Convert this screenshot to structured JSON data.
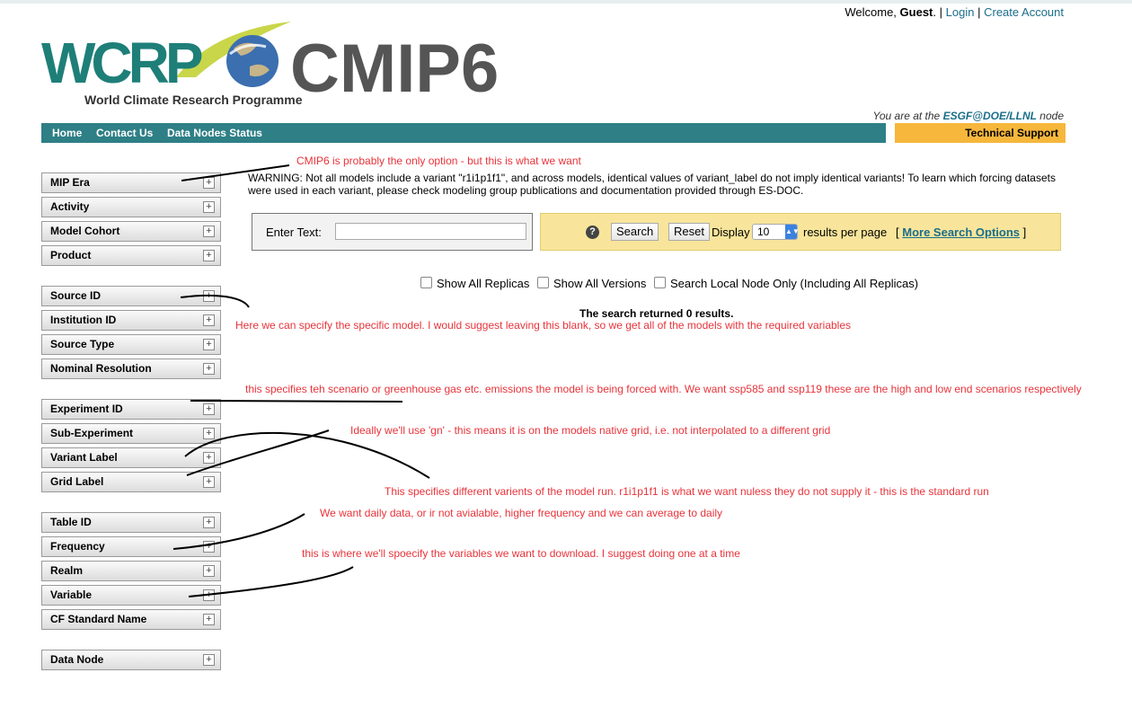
{
  "header": {
    "welcome_prefix": "Welcome,",
    "user": "Guest",
    "welcome_suffix": ".",
    "sep1": "|",
    "login": "Login",
    "sep2": "|",
    "create_account": "Create Account",
    "node_prefix": "You are at the",
    "node_name": "ESGF@DOE/LLNL",
    "node_suffix": "node"
  },
  "logo": {
    "wcrp": "WCRP",
    "tagline": "World Climate Research Programme",
    "cmip": "CMIP6"
  },
  "nav": {
    "items": [
      "Home",
      "Contact Us",
      "Data Nodes Status"
    ],
    "tech_support": "Technical Support"
  },
  "facets": [
    "MIP Era",
    "Activity",
    "Model Cohort",
    "Product",
    "Source ID",
    "Institution ID",
    "Source Type",
    "Nominal Resolution",
    "Experiment ID",
    "Sub-Experiment",
    "Variant Label",
    "Grid Label",
    "Table ID",
    "Frequency",
    "Realm",
    "Variable",
    "CF Standard Name",
    "Data Node"
  ],
  "facet_plus": "+",
  "warning": "WARNING: Not all models include a variant \"r1i1p1f1\", and across models, identical values of variant_label do not imply identical variants! To learn which forcing datasets were used in each variant, please check modeling group publications and documentation provided through ES-DOC.",
  "search": {
    "enter_text_label": "Enter Text:",
    "input_value": "",
    "help": "?",
    "search_button": "Search",
    "reset_button": "Reset",
    "display_label": "Display",
    "results_per_page_value": "10",
    "results_per_page_label": "results per page",
    "more_open": "[",
    "more_options": "More Search Options",
    "more_close": "]"
  },
  "checkboxes": [
    "Show All Replicas",
    "Show All Versions",
    "Search Local Node Only (Including All Replicas)"
  ],
  "result_text": "The search returned 0 results.",
  "annotations": {
    "mip": "CMIP6 is probably the only option - but this is what we want",
    "source": "Here we can specify the specific model. I would suggest leaving this blank, so we get all of the models with the required variables",
    "experiment": "this specifies teh scenario or greenhouse gas etc. emissions the model is being forced with. We want ssp585  and ssp119 these are the high and low end scenarios respectively",
    "grid": "Ideally we'll use 'gn' - this means it is on the models native grid, i.e. not interpolated to a different grid",
    "variant": "This specifies different varients of the model run.  r1i1p1f1  is what we want nuless they do not supply it - this is the standard run",
    "frequency": "We want daily data, or ir not avialable, higher frequency and we can average to daily",
    "variable": "this is where we'll spoecify the variables we want to download. I suggest doing one at a time"
  },
  "colors": {
    "nav_bg": "#2e7f86",
    "tech_bg": "#f6b73c",
    "search_panel_bg": "#f8e59b",
    "annotation": "#e8333a",
    "link": "#1b6e8a"
  }
}
